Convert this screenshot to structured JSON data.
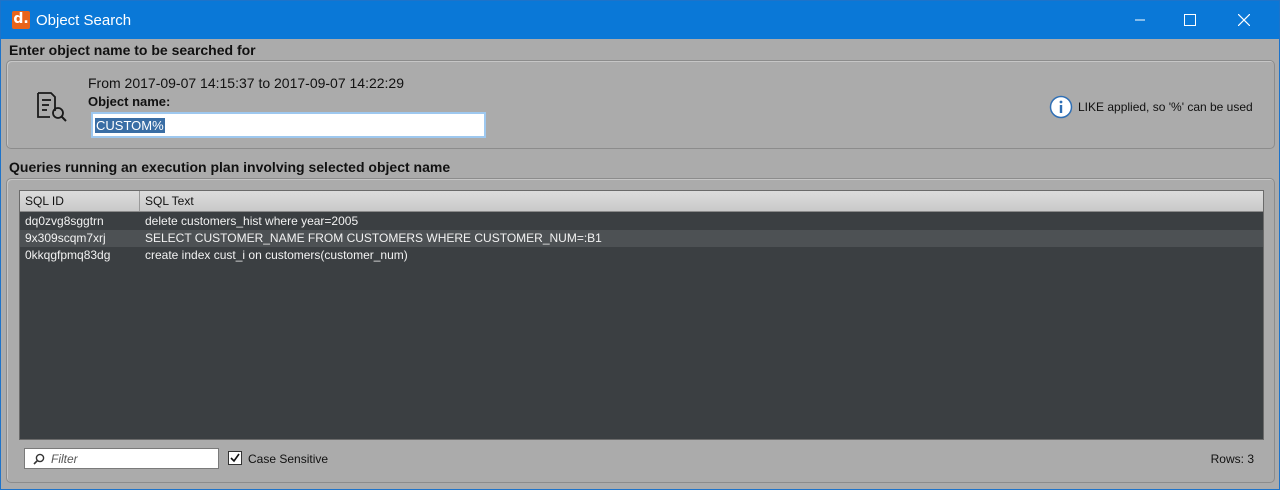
{
  "window": {
    "title": "Object Search",
    "app_icon": "d.",
    "accent": "#0a78d7"
  },
  "search_section": {
    "heading": "Enter object name to be searched for",
    "range_text": "From 2017-09-07 14:15:37 to 2017-09-07 14:22:29",
    "object_name_label": "Object name:",
    "object_name_value": "CUSTOM%",
    "info_text": "LIKE applied, so '%' can be used",
    "icons": [
      "document-search-icon",
      "info-icon"
    ]
  },
  "results_section": {
    "heading": "Queries running an execution plan involving selected object name",
    "columns": [
      "SQL ID",
      "SQL Text"
    ],
    "rows": [
      {
        "sql_id": "dq0zvg8sggtrn",
        "sql_text": "delete customers_hist where year=2005"
      },
      {
        "sql_id": "9x309scqm7xrj",
        "sql_text": "SELECT CUSTOMER_NAME FROM CUSTOMERS WHERE CUSTOMER_NUM=:B1"
      },
      {
        "sql_id": "0kkqgfpmq83dg",
        "sql_text": "create index cust_i on customers(customer_num)"
      }
    ],
    "filter_placeholder": "Filter",
    "case_sensitive_label": "Case Sensitive",
    "case_sensitive_checked": true,
    "rows_label": "Rows: 3"
  }
}
